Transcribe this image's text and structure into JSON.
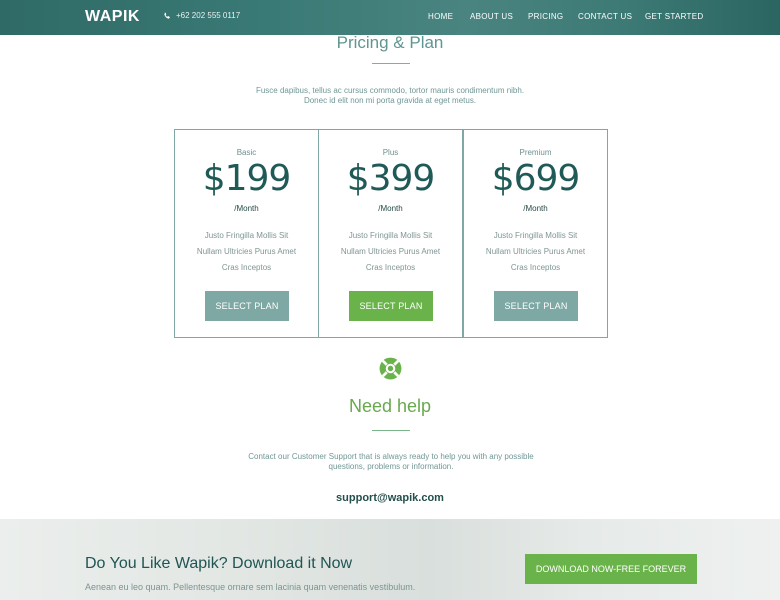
{
  "header": {
    "logo": "WAPIK",
    "phone": "+62 202 555 0117",
    "nav": [
      "HOME",
      "ABOUT US",
      "PRICING",
      "CONTACT US",
      "GET STARTED"
    ]
  },
  "pricing": {
    "title": "Pricing & Plan",
    "intro_line1": "Fusce dapibus, tellus ac cursus commodo, tortor mauris condimentum nibh.",
    "intro_line2": "Donec id elit non mi porta gravida at eget metus.",
    "plans": [
      {
        "name": "Basic",
        "price": "$199",
        "period": "/Month",
        "features": [
          "Justo Fringilla Mollis Sit",
          "Nullam Ultricies Purus Amet",
          "Cras Inceptos"
        ],
        "button": "SELECT PLAN"
      },
      {
        "name": "Plus",
        "price": "$399",
        "period": "/Month",
        "features": [
          "Justo Fringilla Mollis Sit",
          "Nullam Ultricies Purus Amet",
          "Cras Inceptos"
        ],
        "button": "SELECT PLAN"
      },
      {
        "name": "Premium",
        "price": "$699",
        "period": "/Month",
        "features": [
          "Justo Fringilla Mollis Sit",
          "Nullam Ultricies Purus Amet",
          "Cras Inceptos"
        ],
        "button": "SELECT PLAN"
      }
    ]
  },
  "help": {
    "icon": "lifebuoy-icon",
    "title": "Need help",
    "text_line1": "Contact our Customer Support that is always ready to help you with any possible",
    "text_line2": "questions, problems or information.",
    "email": "support@wapik.com"
  },
  "banner": {
    "title": "Do You Like Wapik? Download it Now",
    "subtitle": "Aenean eu leo quam. Pellentesque ornare sem lacinia quam venenatis vestibulum.",
    "button": "DOWNLOAD NOW-FREE FOREVER"
  },
  "colors": {
    "header_teal": "#3a7a76",
    "accent_green": "#6ab34b",
    "button_teal": "#7da8a4",
    "price_text": "#1f5a57"
  }
}
